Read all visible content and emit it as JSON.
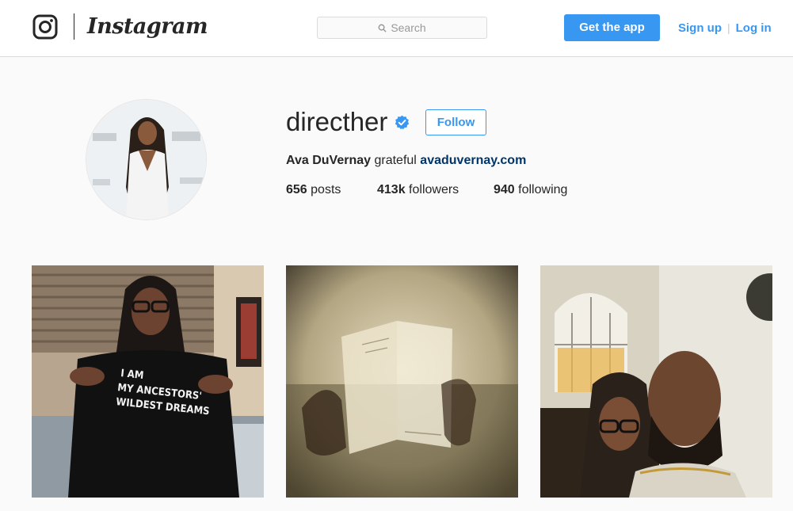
{
  "header": {
    "brand": "Instagram",
    "search_placeholder": "Search",
    "get_app_label": "Get the app",
    "signup_label": "Sign up",
    "separator": "|",
    "login_label": "Log in",
    "accent_color": "#3897f0"
  },
  "profile": {
    "username": "directher",
    "verified": true,
    "follow_label": "Follow",
    "full_name": "Ava DuVernay",
    "bio_text": "grateful",
    "website": "avaduvernay.com",
    "stats": [
      {
        "count": "656",
        "label": "posts"
      },
      {
        "count": "413k",
        "label": "followers"
      },
      {
        "count": "940",
        "label": "following"
      }
    ]
  },
  "posts": [
    {
      "name": "post-shirt",
      "shirt_lines": [
        "I AM",
        "MY ANCESTORS'",
        "WILDEST DREAMS"
      ]
    },
    {
      "name": "post-script"
    },
    {
      "name": "post-selfie"
    }
  ]
}
